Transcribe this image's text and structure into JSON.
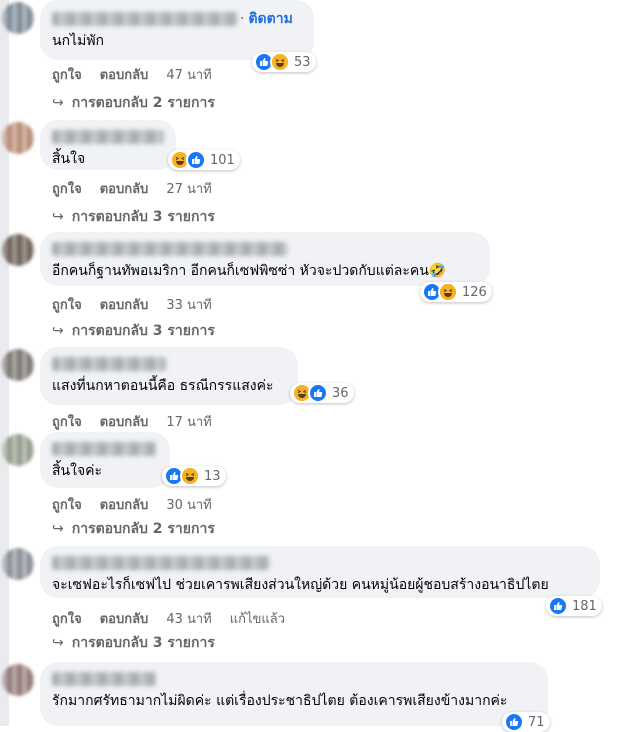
{
  "labels": {
    "like": "ถูกใจ",
    "reply": "ตอบกลับ",
    "follow": "ติดตาม",
    "follow_dot": "·",
    "reply_arrow": "↪"
  },
  "colors": {
    "bubble": "#f0f2f5",
    "link": "#216fdb",
    "meta": "#65676b",
    "like_blue": "#1877f2",
    "haha_yellow": "#f7b125"
  },
  "comments": [
    {
      "author": "(ชื่อเบลอ)",
      "text": "นกไม่พัก",
      "time": "47 นาที",
      "reactions": [
        "like",
        "haha"
      ],
      "reaction_count": "53",
      "replies": "การตอบกลับ 2 รายการ"
    },
    {
      "author": "(ชื่อเบลอ)",
      "text": "สิ้นใจ",
      "time": "27 นาที",
      "reactions": [
        "haha",
        "like"
      ],
      "reaction_count": "101",
      "replies": "การตอบกลับ 3 รายการ"
    },
    {
      "author": "(ชื่อเบลอ)",
      "text": "อีกคนก็ฐานทัพอเมริกา อีกคนก็เซฟพิซซ่า หัวจะปวดกับแต่ละคน🤣",
      "time": "33 นาที",
      "reactions": [
        "like",
        "haha"
      ],
      "reaction_count": "126",
      "replies": "การตอบกลับ 3 รายการ"
    },
    {
      "author": "(ชื่อเบลอ)",
      "text": "แสงที่นกหาตอนนี้คือ ธรณีกรรแสงค่ะ",
      "time": "17 นาที",
      "reactions": [
        "haha",
        "like"
      ],
      "reaction_count": "36",
      "replies": ""
    },
    {
      "author": "(ชื่อเบลอ)",
      "text": "สิ้นใจค่ะ",
      "time": "30 นาที",
      "reactions": [
        "like",
        "haha"
      ],
      "reaction_count": "13",
      "replies": "การตอบกลับ 2 รายการ"
    },
    {
      "author": "(ชื่อเบลอ)",
      "text": "จะเซฟอะไรก็เซฟไป ช่วยเคารพเสียงส่วนใหญ่ด้วย คนหมู่น้อยผู้ชอบสร้างอนาธิปไตย",
      "time": "43 นาที",
      "edited": "แก้ไขแล้ว",
      "reactions": [
        "like"
      ],
      "reaction_count": "181",
      "replies": "การตอบกลับ 3 รายการ"
    },
    {
      "author": "(ชื่อเบลอ)",
      "text": "รักมากศรัทธามากไม่ผิดค่ะ แต่เรื่องประชาธิปไตย ต้องเคารพเสียงข้างมากค่ะ",
      "reactions": [
        "like"
      ],
      "reaction_count": "71"
    }
  ]
}
